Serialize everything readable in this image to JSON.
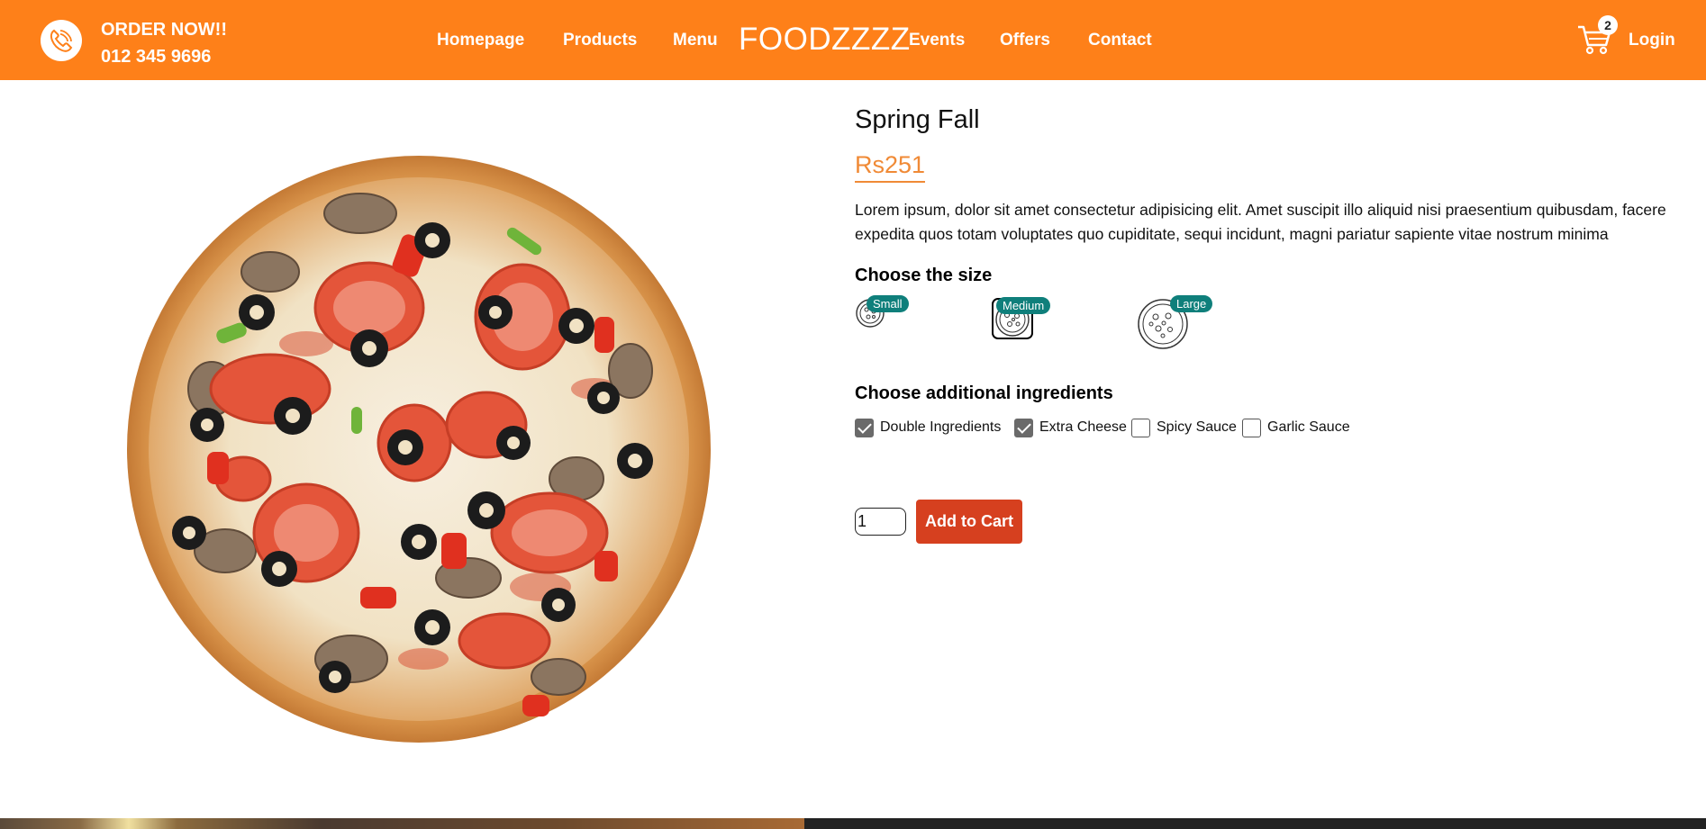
{
  "header": {
    "order_title": "ORDER NOW!!",
    "phone": "012 345 9696",
    "nav_items": [
      "Homepage",
      "Products",
      "Menu",
      "Events",
      "Offers",
      "Contact"
    ],
    "logo": "FOODZZZZ",
    "cart_count": "2",
    "login": "Login",
    "colors": {
      "bar": "#fe8019",
      "text": "#ffffff"
    }
  },
  "product": {
    "name": "Spring Fall",
    "price": "Rs251",
    "description": "Lorem ipsum, dolor sit amet consectetur adipisicing elit. Amet suscipit illo aliquid nisi praesentium quibusdam, facere expedita quos totam voluptates quo cupiditate, sequi incidunt, magni pariatur sapiente vitae nostrum minima",
    "size_heading": "Choose the size",
    "sizes": [
      {
        "label": "Small",
        "selected": false
      },
      {
        "label": "Medium",
        "selected": true
      },
      {
        "label": "Large",
        "selected": false
      }
    ],
    "ingredients_heading": "Choose additional ingredients",
    "ingredients": [
      {
        "label": "Double Ingredients",
        "checked": true
      },
      {
        "label": "Extra Cheese",
        "checked": true
      },
      {
        "label": "Spicy Sauce",
        "checked": false
      },
      {
        "label": "Garlic Sauce",
        "checked": false
      }
    ],
    "quantity": "1",
    "add_to_cart": "Add to Cart",
    "colors": {
      "price": "#f08a36",
      "badge": "#0f7f7b",
      "button": "#d6401f"
    }
  }
}
